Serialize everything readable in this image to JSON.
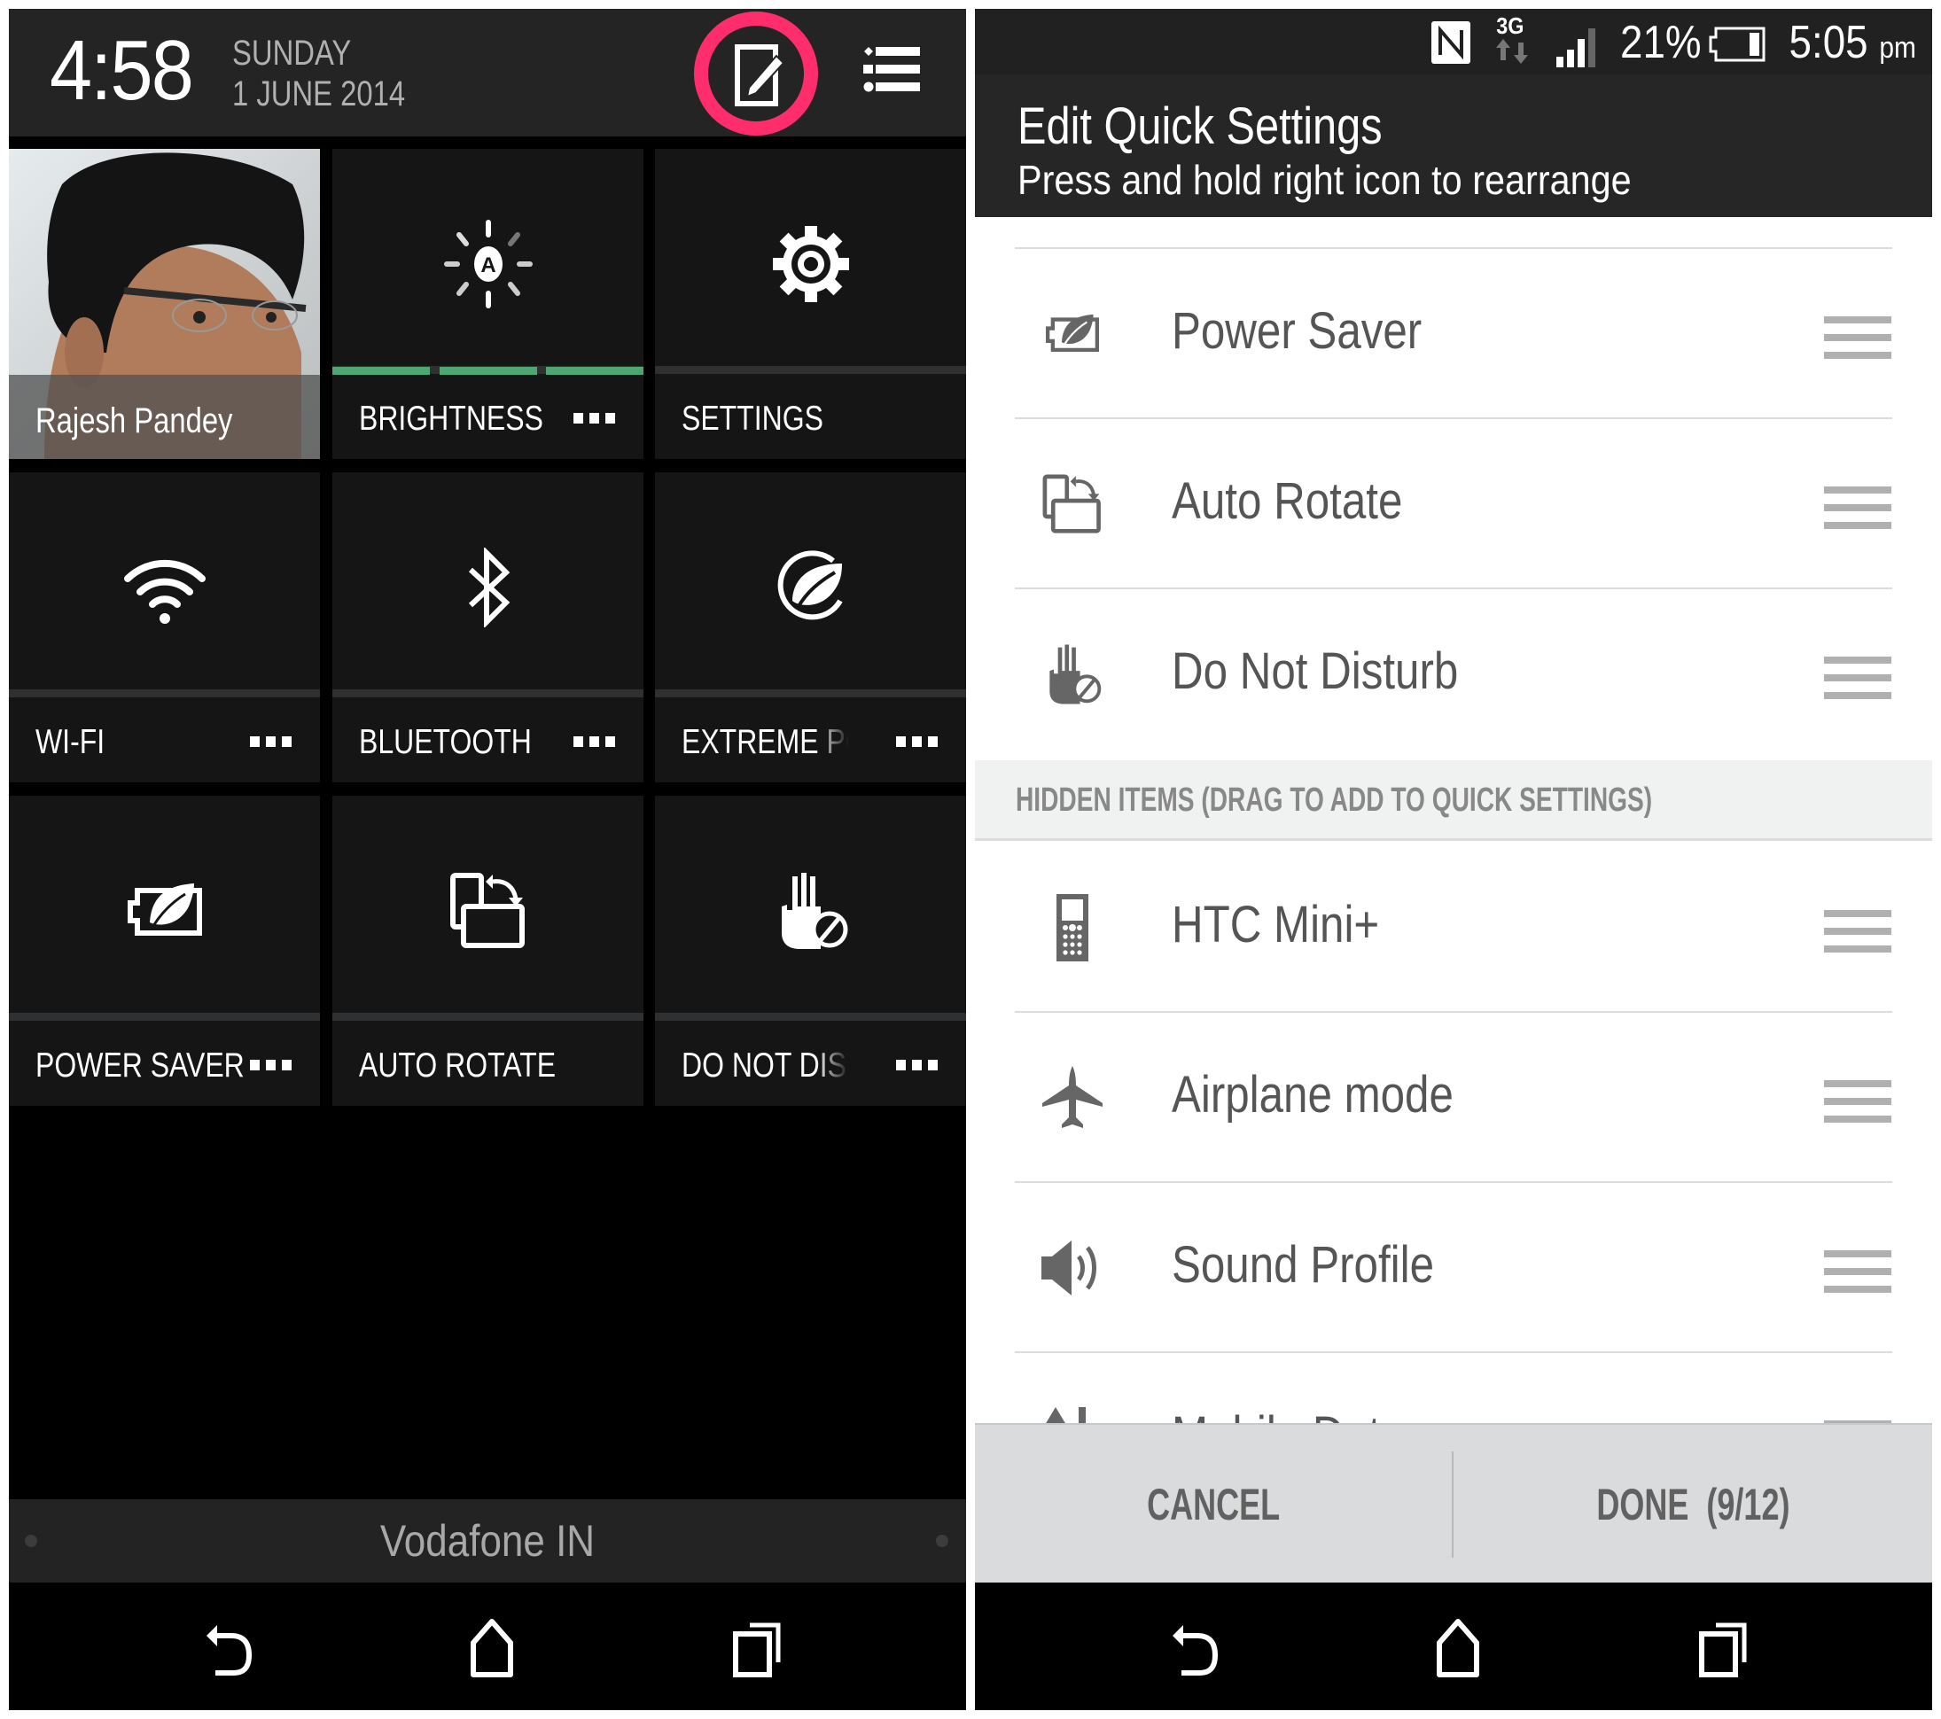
{
  "left_panel": {
    "header": {
      "time": "4:58",
      "day": "SUNDAY",
      "date": "1 JUNE 2014",
      "edit_button_icon": "edit-icon",
      "list_button_icon": "list-icon",
      "highlight_color": "#ff2d6b"
    },
    "tiles": [
      {
        "label": "Rajesh Pandey",
        "icon": "profile-photo",
        "type": "profile"
      },
      {
        "label": "BRIGHTNESS",
        "icon": "auto-brightness-icon",
        "has_more": true,
        "level_segments_on": 3,
        "level_segments_total": 3,
        "accent": "#4ea672"
      },
      {
        "label": "SETTINGS",
        "icon": "gear-icon",
        "has_more": false
      },
      {
        "label": "WI-FI",
        "icon": "wifi-icon",
        "has_more": true
      },
      {
        "label": "BLUETOOTH",
        "icon": "bluetooth-icon",
        "has_more": true
      },
      {
        "label": "EXTREME POWER SAVING",
        "icon": "extreme-power-icon",
        "has_more": true
      },
      {
        "label": "POWER SAVER",
        "icon": "power-saver-icon",
        "has_more": true
      },
      {
        "label": "AUTO ROTATE",
        "icon": "auto-rotate-icon",
        "has_more": false
      },
      {
        "label": "DO NOT DISTURB",
        "icon": "do-not-disturb-icon",
        "has_more": true
      }
    ],
    "carrier": "Vodafone IN",
    "nav": {
      "back": "back-icon",
      "home": "home-icon",
      "recents": "recents-icon"
    }
  },
  "right_panel": {
    "status_bar": {
      "nfc": "nfc-icon",
      "network": "3G",
      "signal_bars": 3,
      "signal_bars_total": 4,
      "battery_percent": "21%",
      "battery_level": 0.21,
      "time": "5:05",
      "ampm": "pm"
    },
    "title": "Edit Quick Settings",
    "subtitle": "Press and hold right icon to rearrange",
    "active_items": [
      {
        "label": "Power Saver",
        "icon": "power-saver-icon"
      },
      {
        "label": "Auto Rotate",
        "icon": "auto-rotate-icon"
      },
      {
        "label": "Do Not Disturb",
        "icon": "do-not-disturb-icon"
      }
    ],
    "hidden_header": "HIDDEN ITEMS (DRAG TO ADD TO QUICK SETTINGS)",
    "hidden_items": [
      {
        "label": "HTC Mini+",
        "icon": "htc-mini-icon"
      },
      {
        "label": "Airplane mode",
        "icon": "airplane-icon"
      },
      {
        "label": "Sound Profile",
        "icon": "speaker-icon"
      },
      {
        "label": "Mobile Data",
        "icon": "mobile-data-icon"
      }
    ],
    "buttons": {
      "cancel": "CANCEL",
      "done": "DONE  (9/12)"
    },
    "nav": {
      "back": "back-icon",
      "home": "home-icon",
      "recents": "recents-icon"
    }
  }
}
